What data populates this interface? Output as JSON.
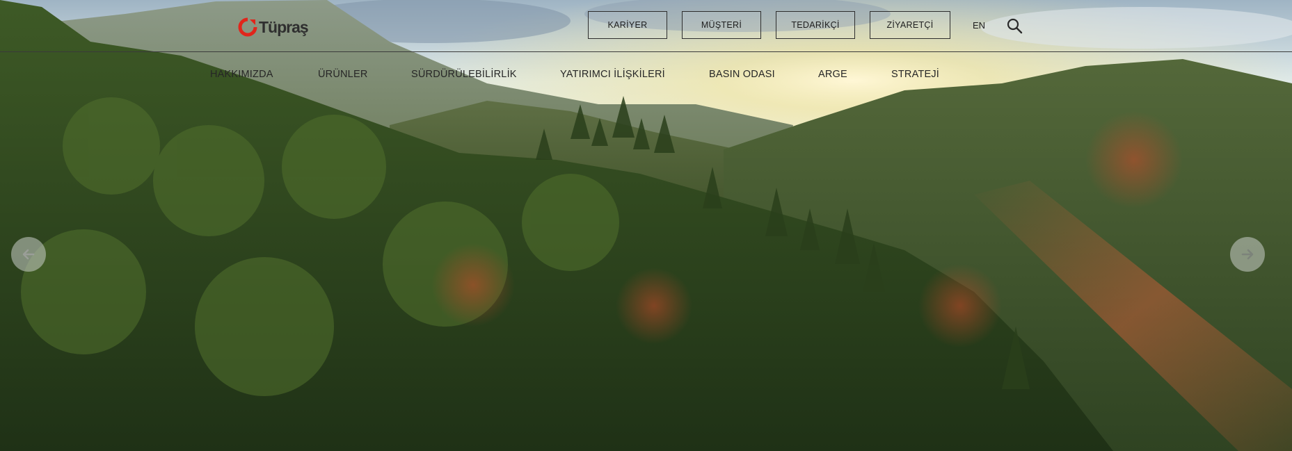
{
  "brand": {
    "logo_text": "Tüpraş",
    "logo_color": "#e1251b"
  },
  "utility": {
    "buttons": [
      "KARİYER",
      "MÜŞTERİ",
      "TEDARİKÇİ",
      "ZİYARETÇİ"
    ],
    "language": "EN",
    "search_icon": "search-icon"
  },
  "nav": {
    "items": [
      "HAKKIMIZDA",
      "ÜRÜNLER",
      "SÜRDÜRÜLEBİLİRLİK",
      "YATIRIMCI İLİŞKİLERİ",
      "BASIN ODASI",
      "ARGE",
      "STRATEJİ"
    ]
  },
  "slider": {
    "prev_icon": "arrow-left-icon",
    "next_icon": "arrow-right-icon"
  }
}
